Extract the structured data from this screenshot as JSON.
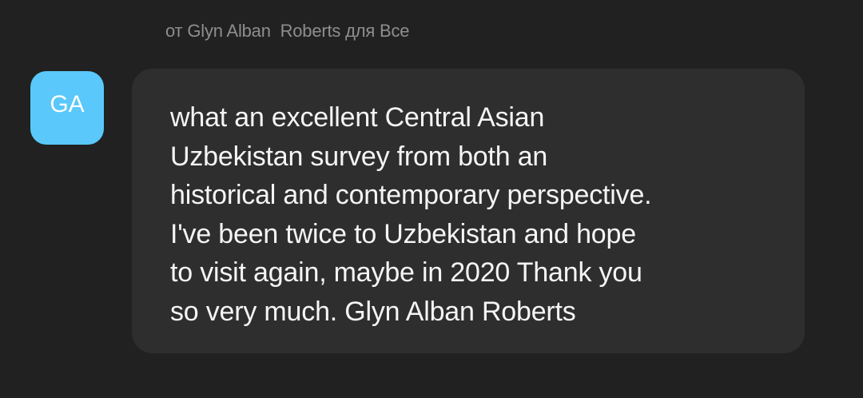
{
  "message": {
    "sender_line": "от Glyn Alban  Roberts для Все",
    "avatar_initials": "GA",
    "avatar_color": "#5ac8fa",
    "text_lines": [
      "what an excellent Central Asian",
      "Uzbekistan survey from both an",
      "historical and contemporary perspective.",
      "I've been twice to Uzbekistan and hope",
      "to visit again, maybe in 2020 Thank you",
      "so very much. Glyn Alban Roberts"
    ]
  }
}
